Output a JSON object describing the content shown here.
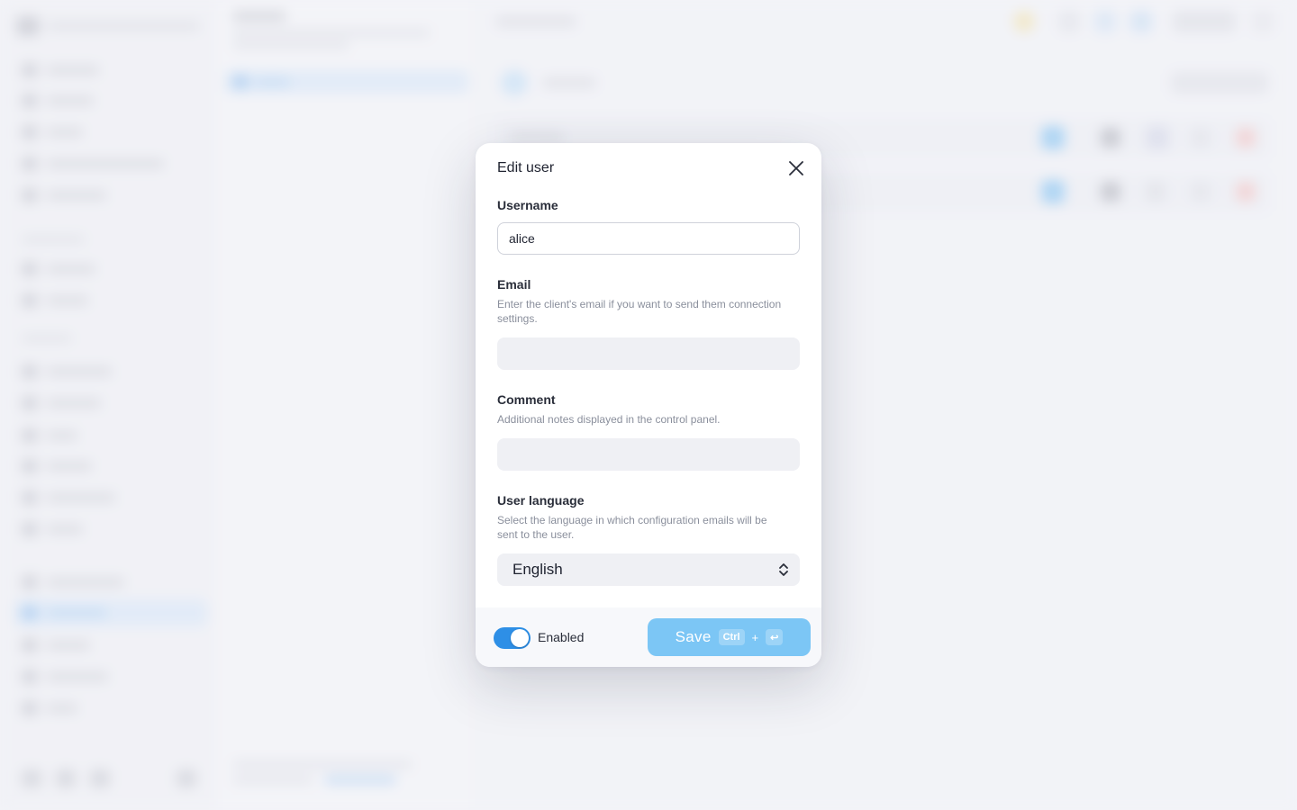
{
  "modal": {
    "title": "Edit user",
    "username": {
      "label": "Username",
      "value": "alice"
    },
    "email": {
      "label": "Email",
      "hint": "Enter the client's email if you want to send them connection settings.",
      "value": ""
    },
    "comment": {
      "label": "Comment",
      "hint": "Additional notes displayed in the control panel.",
      "value": ""
    },
    "language": {
      "label": "User language",
      "hint": "Select the language in which configuration emails will be sent to the user.",
      "selected": "English"
    },
    "footer": {
      "toggle_label": "Enabled",
      "toggle_on": true,
      "save_label": "Save",
      "shortcut_key1": "Ctrl",
      "shortcut_plus": "+",
      "shortcut_key2": "↩"
    }
  },
  "colors": {
    "accent": "#2e8fe6",
    "save_button": "#7cc6f5",
    "danger": "#f3a6a6"
  }
}
